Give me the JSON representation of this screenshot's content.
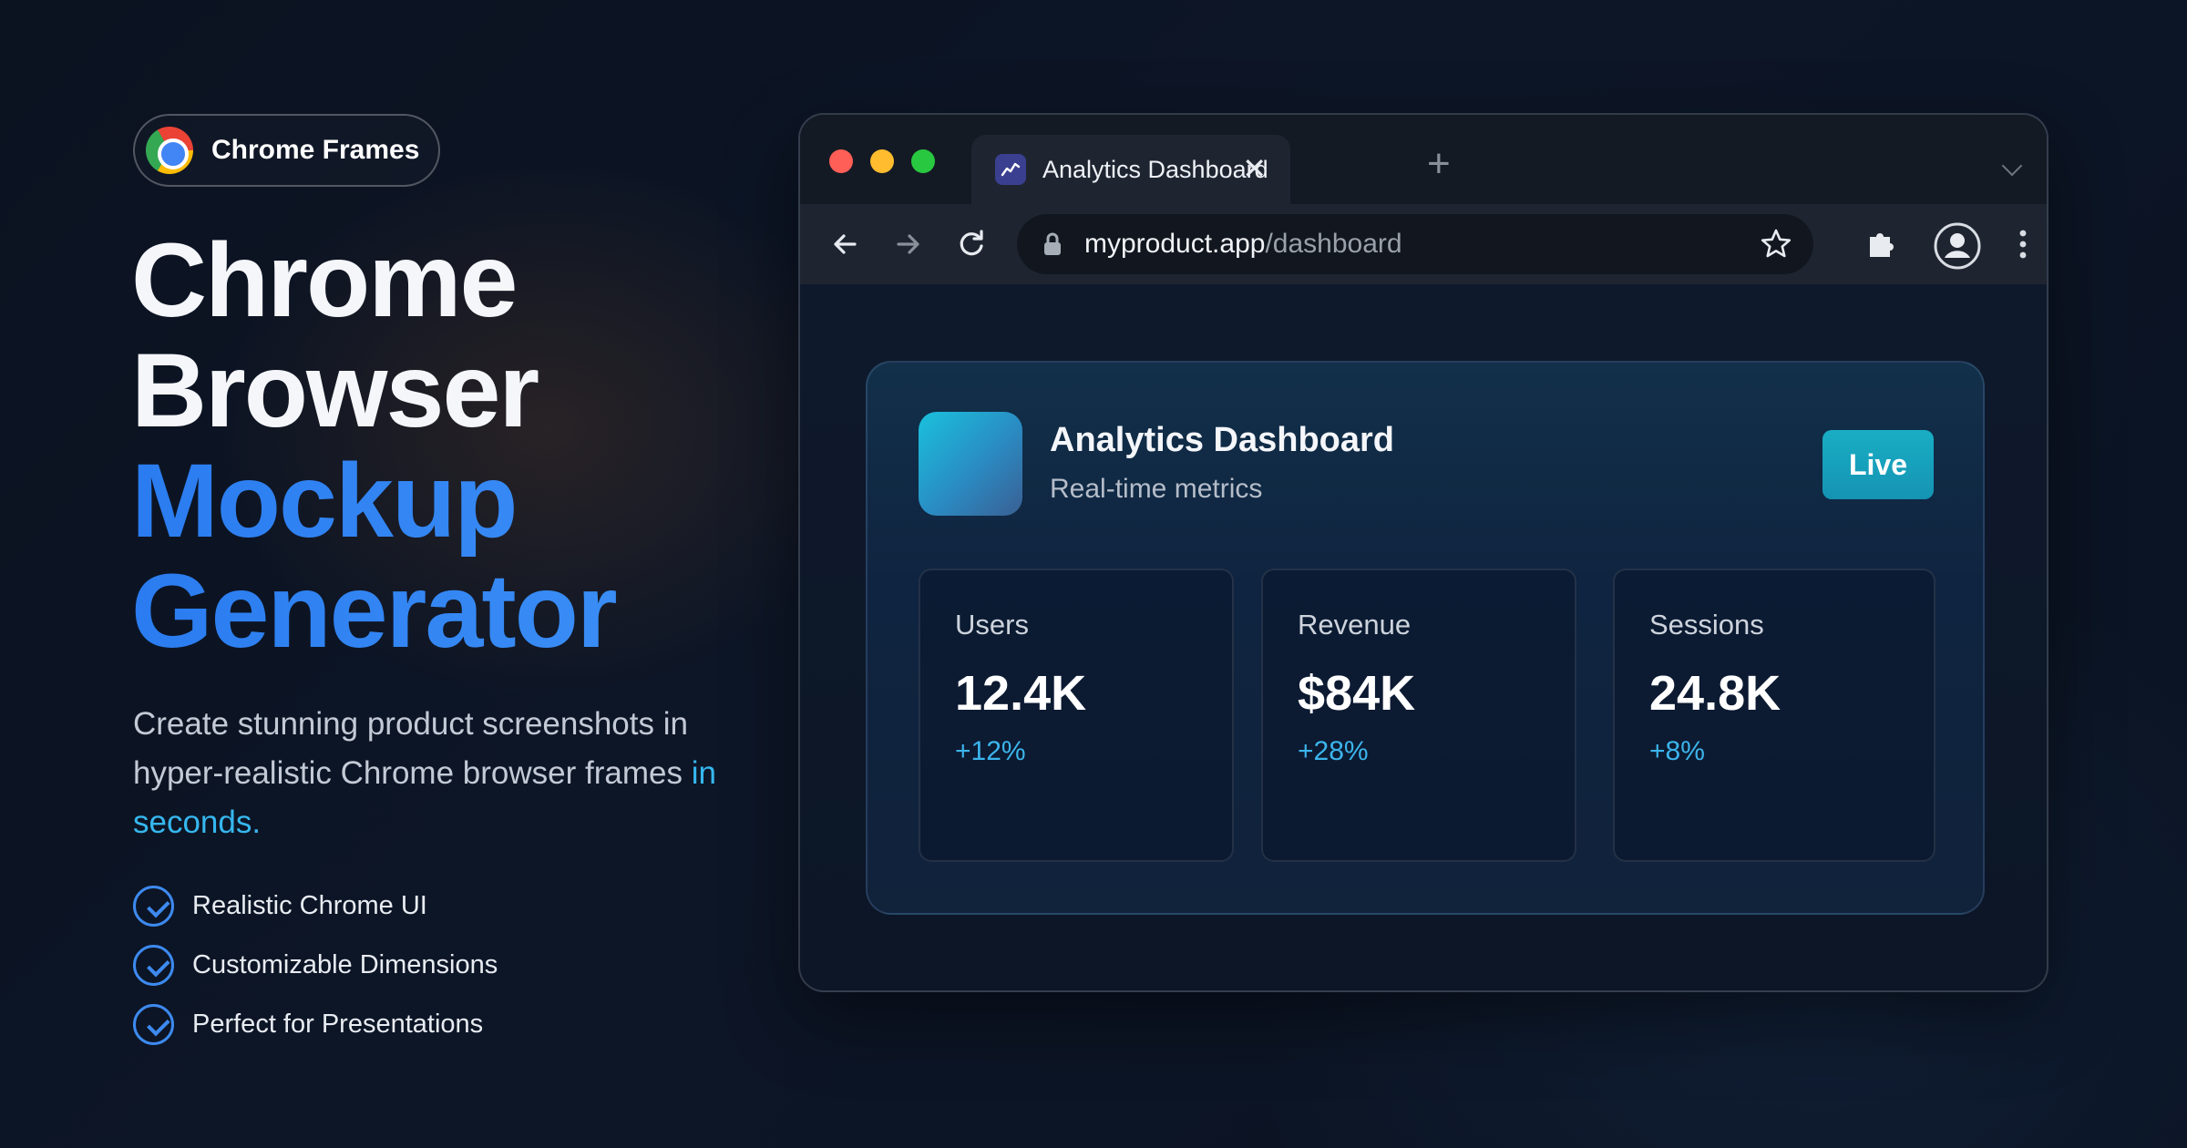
{
  "badge": {
    "label": "Chrome Frames",
    "icon": "chrome-logo-icon"
  },
  "headline": {
    "line1": "Chrome",
    "line2": "Browser",
    "line3": "Mockup",
    "line4": "Generator"
  },
  "description": {
    "text": "Create stunning product screenshots in hyper-realistic Chrome browser frames",
    "accent": "in seconds."
  },
  "features": [
    {
      "label": "Realistic Chrome UI",
      "icon": "check-circle-icon"
    },
    {
      "label": "Customizable Dimensions",
      "icon": "check-circle-icon"
    },
    {
      "label": "Perfect for Presentations",
      "icon": "check-circle-icon"
    }
  ],
  "browser": {
    "tab": {
      "title": "Analytics Dashboard",
      "close": "✕",
      "favicon": "chart-icon"
    },
    "new_tab": "+",
    "address": {
      "domain": "myproduct.app",
      "path": "/dashboard"
    }
  },
  "dashboard": {
    "title": "Analytics Dashboard",
    "subtitle": "Real-time metrics",
    "status": "Live",
    "metrics": [
      {
        "label": "Users",
        "value": "12.4K",
        "change": "+12%"
      },
      {
        "label": "Revenue",
        "value": "$84K",
        "change": "+28%"
      },
      {
        "label": "Sessions",
        "value": "24.8K",
        "change": "+8%"
      }
    ]
  },
  "colors": {
    "accent_blue": "#2a7cf0",
    "accent_cyan": "#36b7ee",
    "background": "#0b1220"
  }
}
